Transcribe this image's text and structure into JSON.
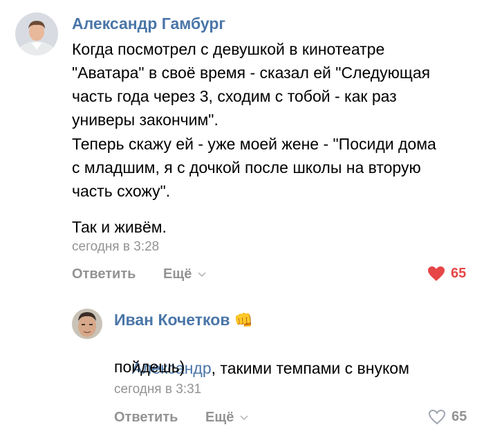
{
  "colors": {
    "author": "#4a76a8",
    "secondary": "#939393",
    "like_active": "#e64646",
    "like_inactive": "#9fa6b0",
    "mention": "#4a76a8"
  },
  "comments": [
    {
      "author": "Александр Гамбург",
      "text_lines": [
        "Когда посмотрел с девушкой в кинотеатре",
        "\"Аватара\" в своё время - сказал ей \"Следующая",
        "часть года через 3, сходим с тобой - как раз",
        "универы закончим\".",
        "Теперь скажу ей - уже моей жене - \"Посиди дома",
        "с младшим, я с дочкой после школы на вторую",
        "часть схожу\".",
        "",
        "Так и живём."
      ],
      "time": "сегодня в 3:28",
      "reply_label": "Ответить",
      "more_label": "Ещё",
      "likes": "65",
      "liked": true,
      "avatar_icon": "user-photo"
    },
    {
      "author": "Иван Кочетков",
      "author_emoji": "👊",
      "mention": "Александр",
      "text_rest_line1": ", такими темпами с внуком",
      "text_line2": "пойдешь)",
      "time": "сегодня в 3:31",
      "reply_label": "Ответить",
      "more_label": "Ещё",
      "likes": "65",
      "liked": false,
      "avatar_icon": "user-photo"
    }
  ]
}
